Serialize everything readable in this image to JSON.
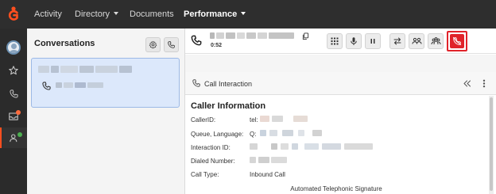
{
  "nav": {
    "logo_icon": "genesys-logo-icon",
    "items": [
      {
        "label": "Activity",
        "dropdown": false,
        "active": false
      },
      {
        "label": "Directory",
        "dropdown": true,
        "active": false
      },
      {
        "label": "Documents",
        "dropdown": false,
        "active": false
      },
      {
        "label": "Performance",
        "dropdown": true,
        "active": true
      }
    ]
  },
  "sidebar": {
    "items": [
      {
        "icon": "avatar-icon",
        "active": false
      },
      {
        "icon": "star-icon",
        "active": false
      },
      {
        "icon": "phone-icon",
        "active": false
      },
      {
        "icon": "inbox-icon",
        "badge_color": "#ff6b3d"
      },
      {
        "icon": "people-icon",
        "badge_color": "#4caf50",
        "active": true
      }
    ]
  },
  "conversations": {
    "title": "Conversations",
    "buttons": [
      "settings-icon",
      "phone-icon"
    ],
    "card": {
      "icon": "phone-icon"
    }
  },
  "call": {
    "timer": "0:52",
    "toolbar": [
      "dialpad-icon",
      "microphone-icon",
      "pause-icon",
      "transfer-icon",
      "consult-icon",
      "conference-icon",
      "end-call-icon"
    ],
    "end_call_color": "#e0232a"
  },
  "interaction": {
    "title": "Call Interaction",
    "section_title": "Caller Information",
    "rows": [
      {
        "label": "CallerID:",
        "value": "tel:"
      },
      {
        "label": "Queue, Language:",
        "value": "Q:"
      },
      {
        "label": "Interaction ID:",
        "value": ""
      },
      {
        "label": "Dialed Number:",
        "value": ""
      },
      {
        "label": "Call Type:",
        "value": "Inbound Call"
      }
    ],
    "footer_text": "Automated Telephonic Signature"
  },
  "colors": {
    "topbar": "#2e2e2e",
    "sidebar": "#2b2b2b",
    "accent": "#ff4f1f",
    "card_bg": "#dce8fb",
    "card_border": "#9cb9e6"
  }
}
